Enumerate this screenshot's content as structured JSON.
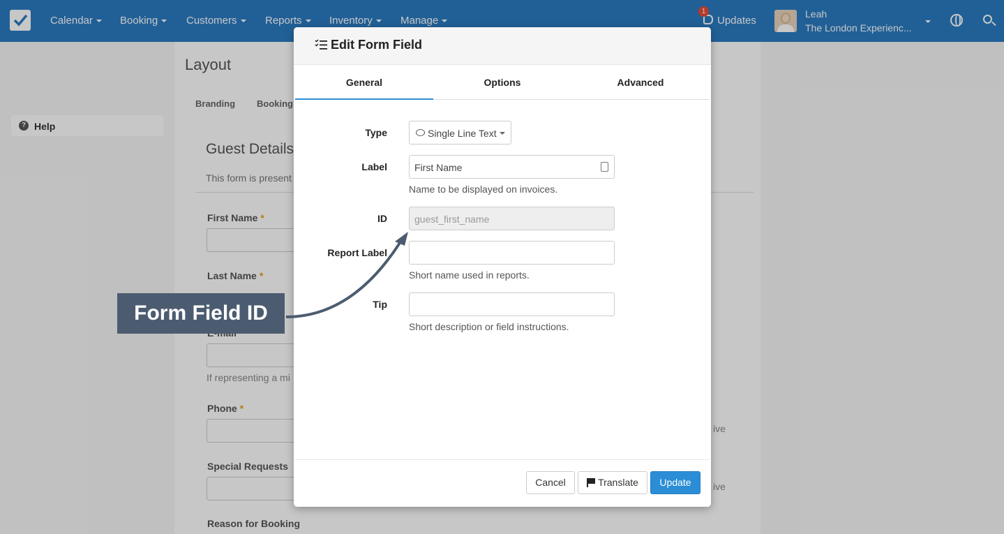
{
  "navbar": {
    "items": [
      {
        "label": "Calendar"
      },
      {
        "label": "Booking"
      },
      {
        "label": "Customers"
      },
      {
        "label": "Reports"
      },
      {
        "label": "Inventory"
      },
      {
        "label": "Manage"
      }
    ],
    "updates_label": "Updates",
    "updates_count": "1",
    "user_name": "Leah",
    "user_company": "The London Experienc..."
  },
  "sidebar": {
    "help_label": "Help"
  },
  "background": {
    "title": "Layout",
    "tabs": [
      {
        "label": "Branding"
      },
      {
        "label": "Booking"
      }
    ],
    "heading": "Guest Details",
    "description": "This form is present",
    "fields": [
      {
        "label": "First Name",
        "required": "*"
      },
      {
        "label": "Last Name",
        "required": "*"
      },
      {
        "label": "E-mail",
        "required": "*"
      },
      {
        "label": "Phone",
        "required": "*"
      },
      {
        "label": "Special Requests"
      },
      {
        "label": "Reason for Booking"
      }
    ],
    "email_help": "If representing a mi",
    "side_text_1": "ive",
    "side_text_2": "ive"
  },
  "modal": {
    "title": "Edit Form Field",
    "tabs": [
      {
        "label": "General",
        "active": true
      },
      {
        "label": "Options"
      },
      {
        "label": "Advanced"
      }
    ],
    "fields": {
      "type": {
        "label": "Type",
        "value": "Single Line Text"
      },
      "label": {
        "label": "Label",
        "value": "First Name",
        "help": "Name to be displayed on invoices."
      },
      "id": {
        "label": "ID",
        "placeholder": "guest_first_name"
      },
      "report_label": {
        "label": "Report Label",
        "value": "",
        "help": "Short name used in reports."
      },
      "tip": {
        "label": "Tip",
        "value": "",
        "help": "Short description or field instructions."
      }
    },
    "buttons": {
      "cancel": "Cancel",
      "translate": "Translate",
      "update": "Update"
    }
  },
  "callout": {
    "text": "Form Field ID"
  },
  "colors": {
    "navbar": "#2b7cc2",
    "primary": "#2b8dd6",
    "callout": "#4c5c70",
    "badge": "#e94b35"
  }
}
